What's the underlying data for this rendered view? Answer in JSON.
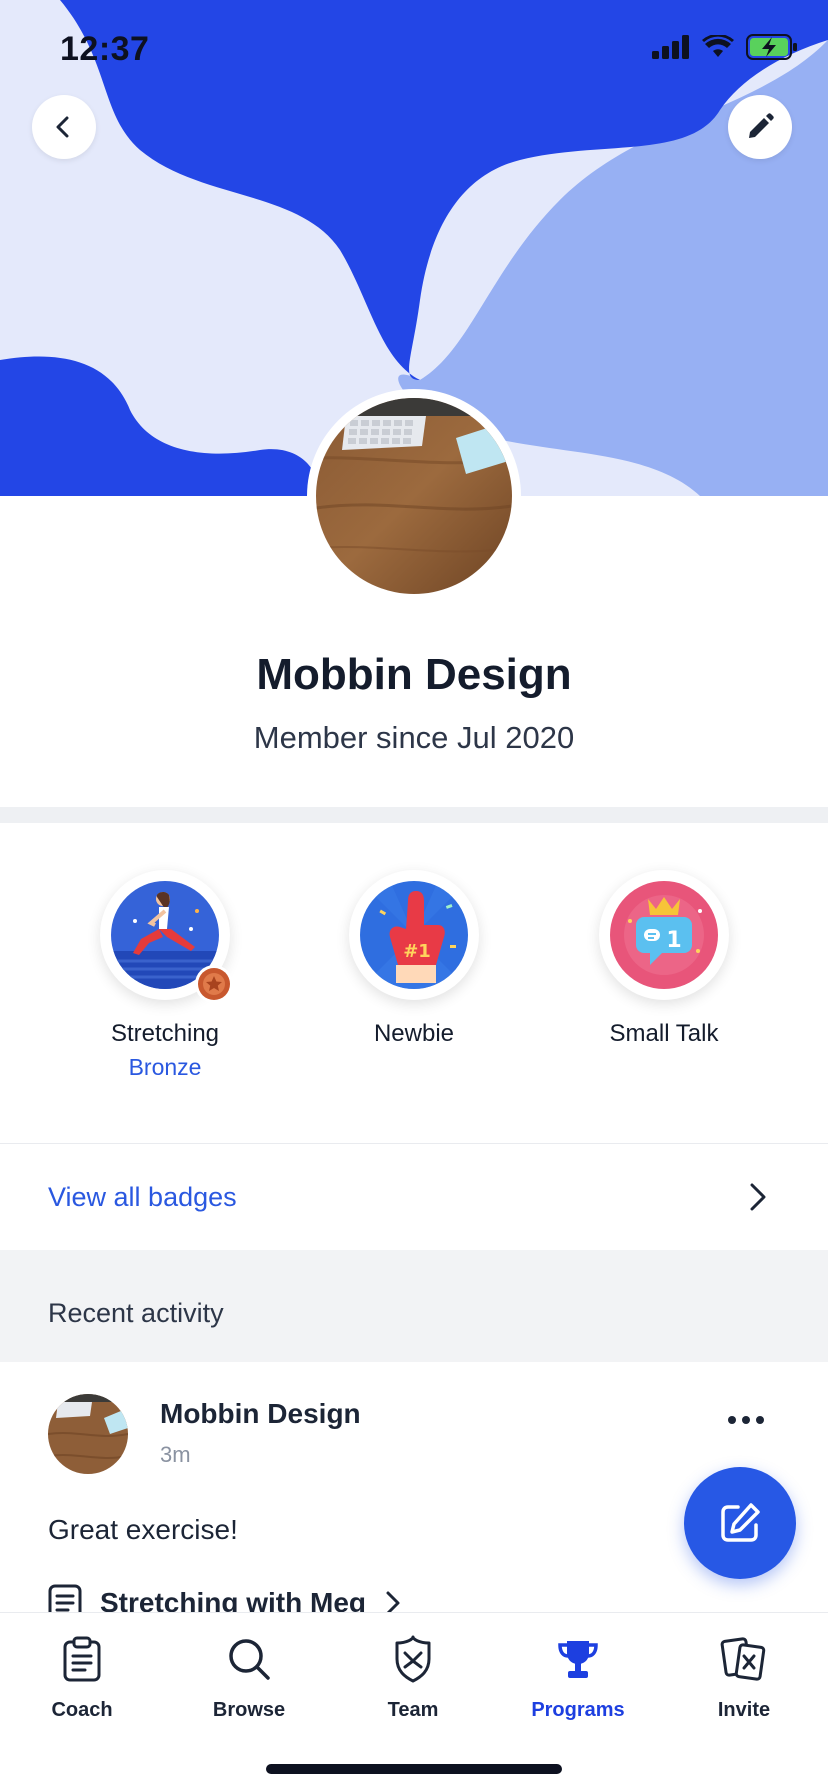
{
  "status_bar": {
    "time": "12:37"
  },
  "profile": {
    "name": "Mobbin Design",
    "member_since": "Member since Jul 2020"
  },
  "badges": [
    {
      "label": "Stretching",
      "level": "Bronze",
      "icon": "stretching-badge-icon"
    },
    {
      "label": "Newbie",
      "level": "",
      "icon": "foam-finger-badge-icon"
    },
    {
      "label": "Small Talk",
      "level": "",
      "icon": "chat-crown-badge-icon"
    }
  ],
  "view_all_badges": "View all badges",
  "recent_activity": {
    "title": "Recent activity",
    "post": {
      "author": "Mobbin Design",
      "time": "3m",
      "text": "Great exercise!",
      "link_text": "Stretching with Meg"
    }
  },
  "tabs": [
    {
      "label": "Coach",
      "icon": "clipboard-icon",
      "active": false
    },
    {
      "label": "Browse",
      "icon": "search-icon",
      "active": false
    },
    {
      "label": "Team",
      "icon": "shield-icon",
      "active": false
    },
    {
      "label": "Programs",
      "icon": "trophy-icon",
      "active": true
    },
    {
      "label": "Invite",
      "icon": "invite-cards-icon",
      "active": false
    }
  ],
  "colors": {
    "primary": "#2a58e0",
    "header_dark": "#2346e6",
    "header_light": "#e4e9fb",
    "header_mid": "#97b0f3",
    "fab": "#2758e5"
  }
}
